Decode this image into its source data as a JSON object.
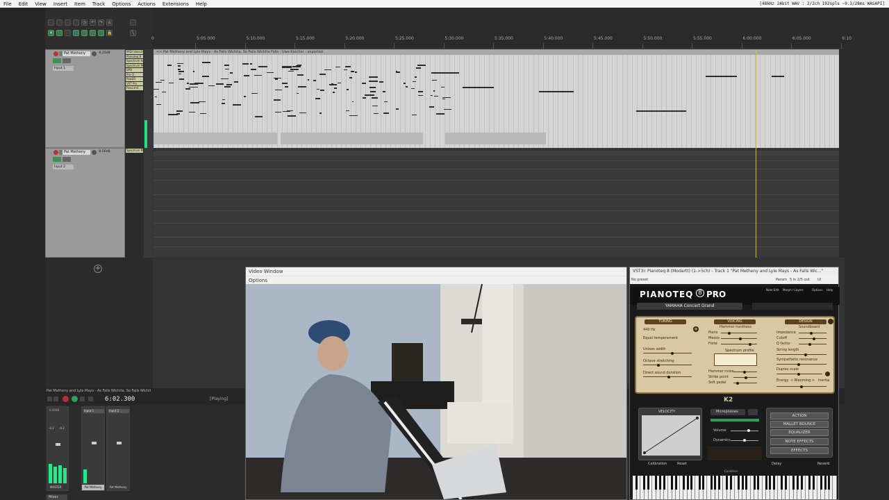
{
  "menubar": {
    "items": [
      "File",
      "Edit",
      "View",
      "Insert",
      "Item",
      "Track",
      "Options",
      "Actions",
      "Extensions",
      "Help"
    ],
    "status": "[48kHz 24bit WAV : 2/2ch 192spls ~9.3/28ms WASAPI]"
  },
  "ruler": {
    "ticks": [
      "5:05.000",
      "5:10.000",
      "5:15.000",
      "5:20.000",
      "5:25.000",
      "5:30.000",
      "5:35.000",
      "5:40.000",
      "5:45.000",
      "5:50.000",
      "5:55.000",
      "6:00.000",
      "6:05.000",
      "6:10"
    ]
  },
  "tracks": [
    {
      "name": "Pat Metheny",
      "volume": "-0.25dB",
      "input": "Input 1",
      "fx": [
        "MIDI Velocity",
        "Pianoteq 8",
        "Spectrum Analyzer",
        "Spectrum M",
        "SPD",
        "Pro-Q",
        "ReaEQ",
        "VST Pro",
        "ReaLimit"
      ]
    },
    {
      "name": "Pat Metheny",
      "volume": "-0.56dB",
      "input": "Input 2",
      "fx": [
        "Spectrum M"
      ]
    }
  ],
  "items": {
    "midi_title": "<< Pat Metheny and Lyle Mays - As Falls Wichita, So Falls Wichita Falls - Uwe Karcher - exported"
  },
  "transport": {
    "project": "Pat Metheny and Lyle Mays - As Falls Wichita, So Falls Wichita Falls",
    "time": "6:02.300",
    "state": "[Playing]"
  },
  "mixer": {
    "master_label": "MASTER",
    "master_peak_l": "-0.2",
    "master_peak_r": "-0.2",
    "master_vol": "0.00dB",
    "strip1_label": "Pat Metheny",
    "strip2_label": "Pat Metheny",
    "strip1_input": "Input 1",
    "strip2_input": "Input 2",
    "mixer_tab": "Mixer"
  },
  "video": {
    "title": "Video Window",
    "options": "Options"
  },
  "vst": {
    "title": "VST3i: Pianoteq 8 (Modartt) (1->5ch) - Track 1 \"Pat Metheny and Lyle Mays - As Falls Wic...\"",
    "preset": "No preset",
    "param": "Param",
    "io": "5 in 2/5 out",
    "ui": "UI",
    "brand": "PIANOTEQ",
    "version": "8",
    "edition": "PRO",
    "menu": [
      "Note Edit",
      "Morph / Layers",
      "Options",
      "Help"
    ],
    "instrument": "YAMAHA Concert Grand",
    "tuning": {
      "header": "TUNING",
      "hz": "440 Hz",
      "temperament": "Equal temperament",
      "params": [
        "Unison width",
        "Octave stretching",
        "Direct sound duration"
      ]
    },
    "voicing": {
      "header": "VOICING",
      "hammer": "Hammer hardness",
      "params": [
        "Piano",
        "Mezzo",
        "Forte"
      ],
      "spectrum": "Spectrum profile",
      "params2": [
        "Hammer noise",
        "Strike point",
        "Soft pedal"
      ]
    },
    "design": {
      "header": "DESIGN",
      "soundboard": "Soundboard",
      "params": [
        "Impedance",
        "Cutoff",
        "Q factor",
        "String length",
        "Sympathetic resonance",
        "Duplex scale"
      ],
      "blooming_left": "Energy",
      "blooming": "< Blooming >",
      "blooming_right": "Inertia"
    },
    "logo": "K2",
    "velocity": {
      "title": "VELOCITY",
      "calibration": "Calibration",
      "reset": "Reset"
    },
    "microphones": {
      "label": "Microphones",
      "volume": "Volume",
      "dynamics": "Dynamics"
    },
    "buttons": [
      "ACTION",
      "MALLET BOUNCE",
      "EQUALIZER",
      "NOTE EFFECTS",
      "EFFECTS"
    ],
    "delay": "Delay",
    "reverb": "Reverb",
    "condition": "Condition"
  }
}
